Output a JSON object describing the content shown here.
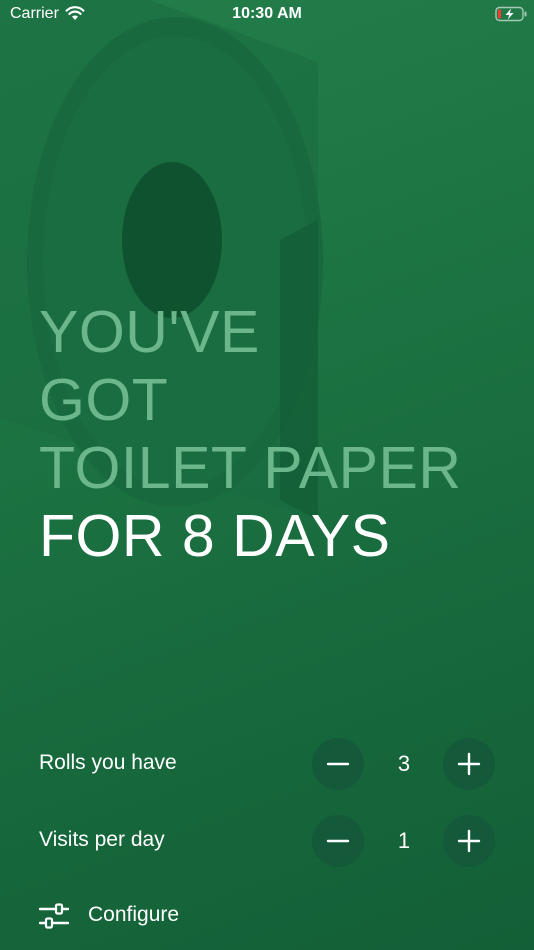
{
  "status_bar": {
    "carrier": "Carrier",
    "time": "10:30 AM",
    "icons": [
      "wifi-icon",
      "battery-charging-icon"
    ]
  },
  "headline": {
    "lines": [
      "YOU'VE",
      "GOT",
      "TOILET PAPER"
    ],
    "result": "FOR 8 DAYS"
  },
  "rolls": {
    "label": "Rolls you have",
    "value": "3",
    "icons": [
      "minus-icon",
      "plus-icon"
    ]
  },
  "visits": {
    "label": "Visits per day",
    "value": "1",
    "icons": [
      "minus-icon",
      "plus-icon"
    ]
  },
  "configure": {
    "label": "Configure",
    "icon": "sliders-icon"
  },
  "colors": {
    "background": "#1d7443",
    "dim_text": "#6bb68a",
    "button": "#14593a",
    "text": "#ffffff"
  }
}
